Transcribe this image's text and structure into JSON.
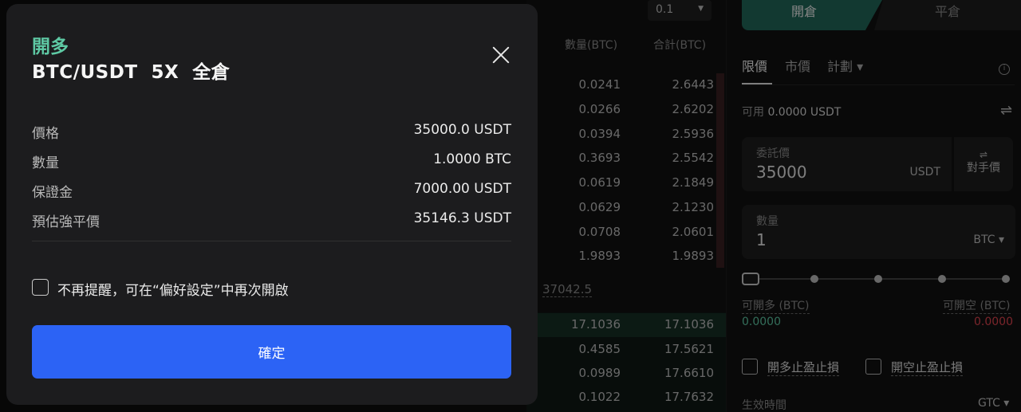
{
  "orderbook": {
    "precision": "0.1",
    "headers": {
      "qty": "數量(BTC)",
      "sum": "合計(BTC)"
    },
    "asks": [
      {
        "qty": "0.0241",
        "sum": "2.6443"
      },
      {
        "qty": "0.0266",
        "sum": "2.6202"
      },
      {
        "qty": "0.0394",
        "sum": "2.5936"
      },
      {
        "qty": "0.3693",
        "sum": "2.5542"
      },
      {
        "qty": "0.0619",
        "sum": "2.1849"
      },
      {
        "qty": "0.0629",
        "sum": "2.1230"
      },
      {
        "qty": "0.0708",
        "sum": "2.0601"
      },
      {
        "qty": "1.9893",
        "sum": "1.9893"
      }
    ],
    "mid_price": "37042.5",
    "bids": [
      {
        "qty": "17.1036",
        "sum": "17.1036"
      },
      {
        "qty": "0.4585",
        "sum": "17.5621"
      },
      {
        "qty": "0.0989",
        "sum": "17.6610"
      },
      {
        "qty": "0.1022",
        "sum": "17.7632"
      }
    ]
  },
  "form": {
    "tab_open": "開倉",
    "tab_close": "平倉",
    "order_types": [
      "限價",
      "市價",
      "計劃 ▾"
    ],
    "available_label": "可用",
    "available_value": "0.0000 USDT",
    "price_label": "委託價",
    "price_value": "35000",
    "price_unit": "USDT",
    "counterparty_label": "對手價",
    "qty_label": "數量",
    "qty_value": "1",
    "qty_unit": "BTC ▾",
    "can_long_label": "可開多 (BTC)",
    "can_long_value": "0.0000",
    "can_short_label": "可開空 (BTC)",
    "can_short_value": "0.0000",
    "tpsl_long": "開多止盈止損",
    "tpsl_short": "開空止盈止損",
    "effective_time_label": "生效時間",
    "effective_time_value": "GTC ▾",
    "colors": {
      "long": "#5ec9a4",
      "short": "#e0444f"
    }
  },
  "modal": {
    "side": "開多",
    "subtitle": "BTC/USDT  5X  全倉",
    "rows": [
      {
        "key": "價格",
        "value": "35000.0 USDT"
      },
      {
        "key": "數量",
        "value": "1.0000 BTC"
      },
      {
        "key": "保證金",
        "value": "7000.00 USDT"
      },
      {
        "key": "預估強平價",
        "value": "35146.3 USDT"
      }
    ],
    "dont_remind_label": "不再提醒，可在“偏好設定”中再次開啟",
    "confirm_label": "確定",
    "accent": "#2c63f5"
  }
}
